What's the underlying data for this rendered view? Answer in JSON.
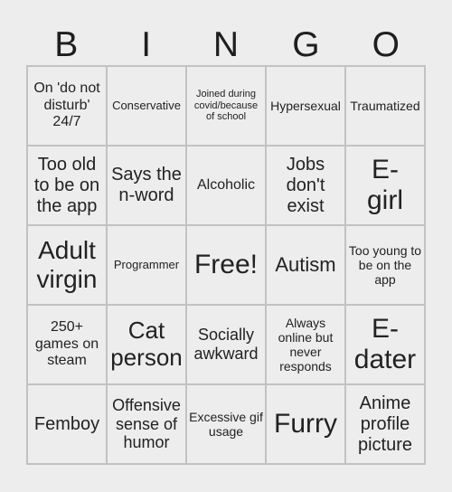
{
  "header": [
    "B",
    "I",
    "N",
    "G",
    "O"
  ],
  "cells": [
    [
      "On 'do not disturb' 24/7",
      "Conservative",
      "Joined during covid/because of school",
      "Hypersexual",
      "Traumatized"
    ],
    [
      "Too old to be on the app",
      "Says the n-word",
      "Alcoholic",
      "Jobs don't exist",
      "E-girl"
    ],
    [
      "Adult virgin",
      "Programmer",
      "Free!",
      "Autism",
      "Too young to be on the app"
    ],
    [
      "250+ games on steam",
      "Cat person",
      "Socially awkward",
      "Always online but never responds",
      "E-dater"
    ],
    [
      "Femboy",
      "Offensive sense of humor",
      "Excessive gif usage",
      "Furry",
      "Anime profile picture"
    ]
  ]
}
